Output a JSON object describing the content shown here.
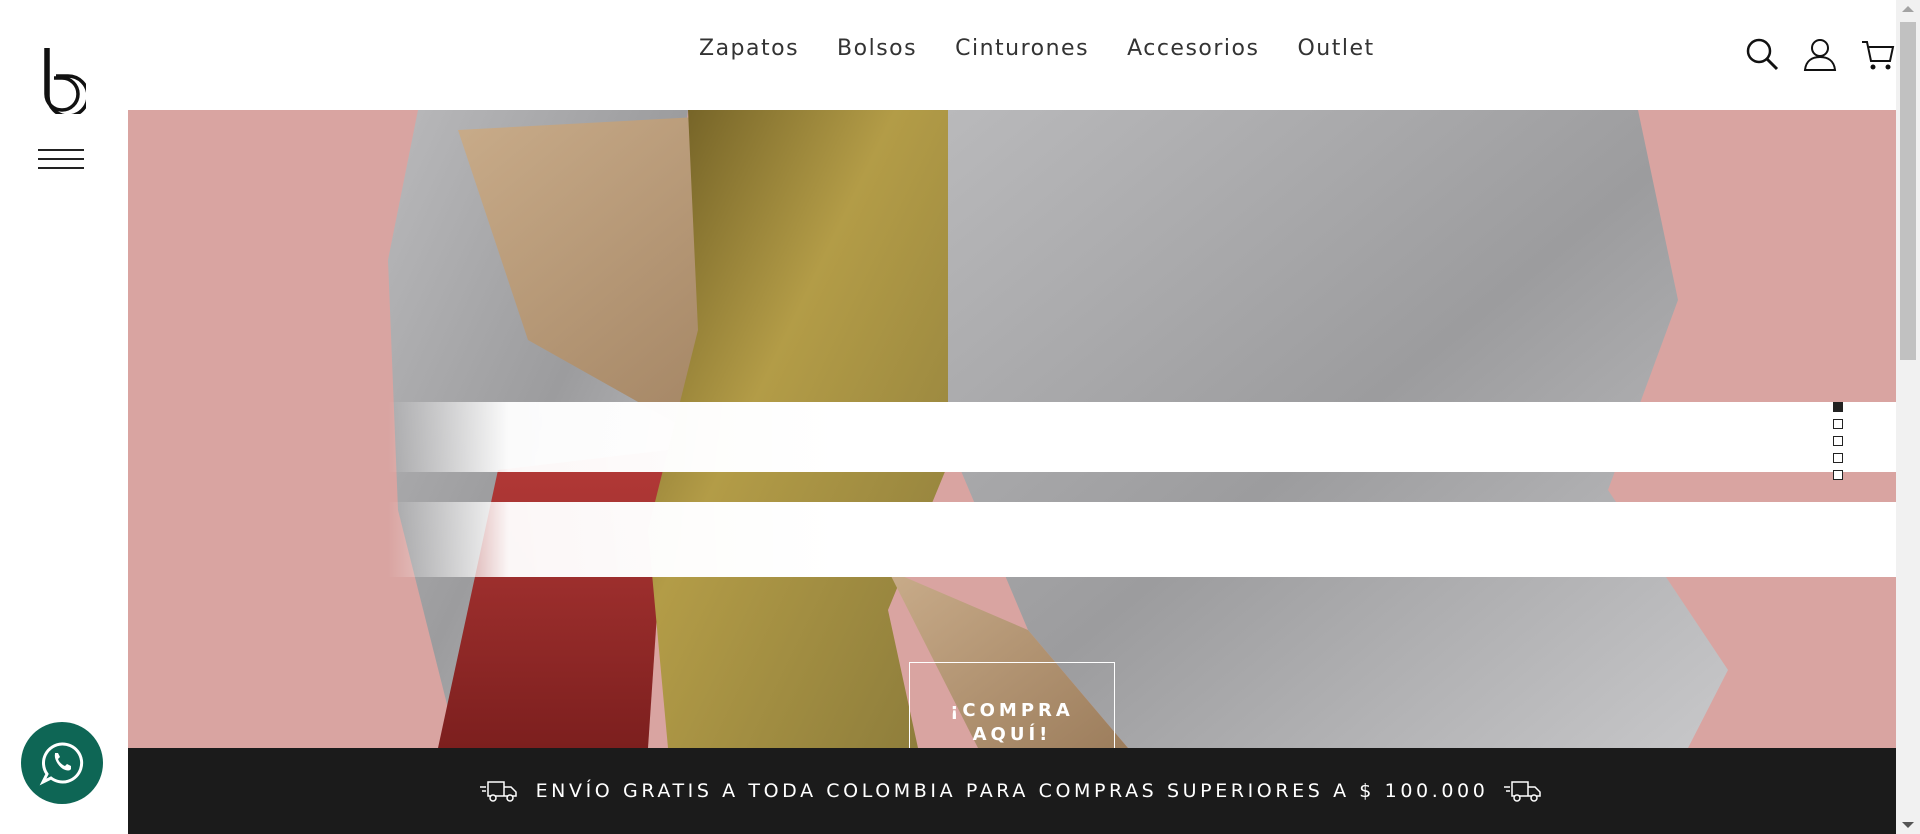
{
  "brand": {
    "logo_icon": "b-logo-icon"
  },
  "nav": {
    "items": [
      "Zapatos",
      "Bolsos",
      "Cinturones",
      "Accesorios",
      "Outlet"
    ]
  },
  "header_icons": [
    "search-icon",
    "user-icon",
    "cart-icon"
  ],
  "hero": {
    "cta_line1": "¡COMPRA",
    "cta_line2": "AQUÍ!",
    "slides_count": 5,
    "active_slide": 1,
    "background_color": "#d9a4a1"
  },
  "banner": {
    "text": "ENVÍO GRATIS A TODA COLOMBIA PARA COMPRAS SUPERIORES A $ 100.000",
    "icon": "delivery-truck-icon"
  },
  "whatsapp": {
    "icon": "whatsapp-icon",
    "color": "#0e6655"
  }
}
